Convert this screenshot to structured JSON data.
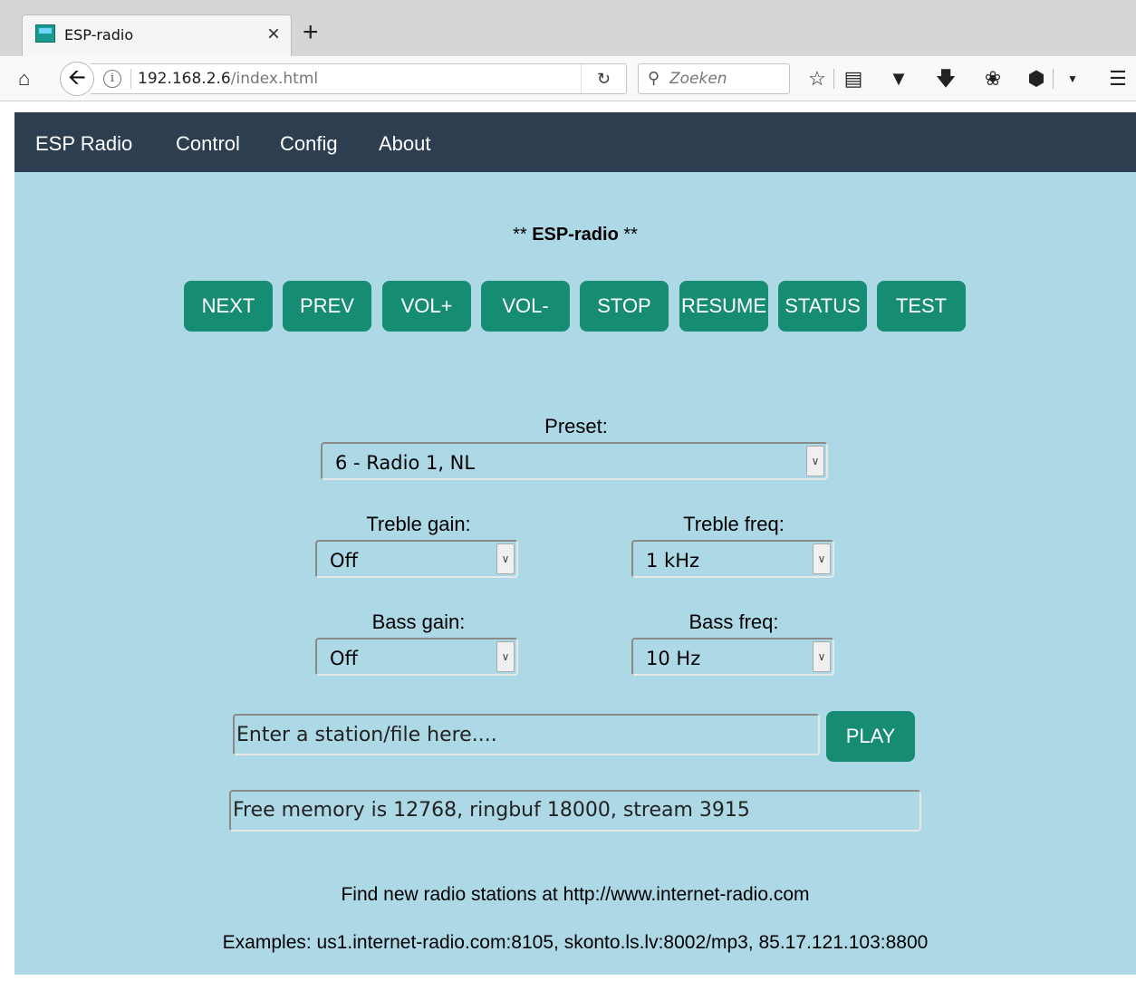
{
  "browser": {
    "tab_title": "ESP-radio",
    "tab_close": "×",
    "new_tab": "+",
    "url_host": "192.168.2.6",
    "url_path": "/index.html",
    "search_placeholder": "Zoeken"
  },
  "nav": {
    "brand": "ESP Radio",
    "items": [
      "Control",
      "Config",
      "About"
    ]
  },
  "title": {
    "prefix": "** ",
    "name": "ESP-radio",
    "suffix": " **"
  },
  "buttons": [
    "NEXT",
    "PREV",
    "VOL+",
    "VOL-",
    "STOP",
    "RESUME",
    "STATUS",
    "TEST"
  ],
  "preset": {
    "label": "Preset:",
    "value": "6 - Radio 1, NL"
  },
  "treble_gain": {
    "label": "Treble gain:",
    "value": "Off"
  },
  "treble_freq": {
    "label": "Treble freq:",
    "value": "1 kHz"
  },
  "bass_gain": {
    "label": "Bass gain:",
    "value": "Off"
  },
  "bass_freq": {
    "label": "Bass freq:",
    "value": "10 Hz"
  },
  "station": {
    "placeholder": "Enter a station/file here....",
    "play_label": "PLAY"
  },
  "status": {
    "value": "Free memory is 12768, ringbuf 18000, stream 3915"
  },
  "footer": {
    "find": "Find new radio stations at http://www.internet-radio.com",
    "examples": "Examples: us1.internet-radio.com:8105, skonto.ls.lv:8002/mp3, 85.17.121.103:8800"
  },
  "colors": {
    "page_bg": "#add8e6",
    "nav_bg": "#2d3e50",
    "button_bg": "#168c73"
  }
}
